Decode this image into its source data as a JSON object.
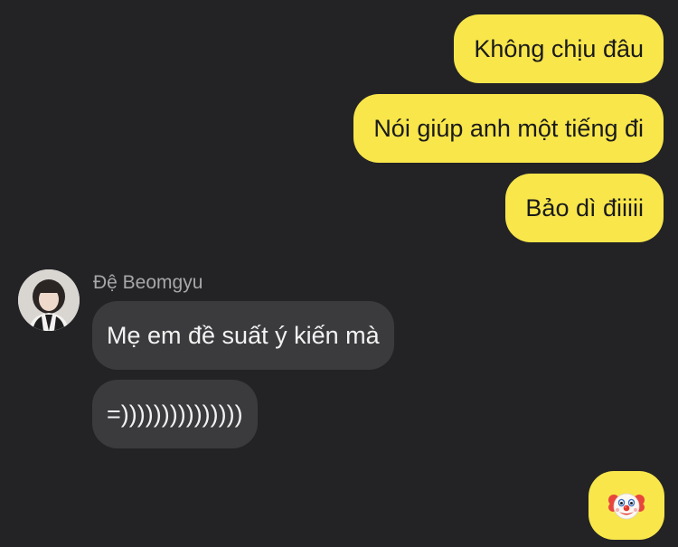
{
  "conversation": {
    "outgoing": [
      "Không chịu đâu",
      "Nói giúp anh một tiếng đi",
      "Bảo dì điiiii"
    ],
    "sender": {
      "name": "Đệ Beomgyu"
    },
    "incoming": [
      "Mẹ em đề suất ý kiến mà",
      "=)))))))))))))))"
    ],
    "final_emoji": "clown-face-emoji"
  },
  "colors": {
    "background": "#232325",
    "outgoing_bubble": "#f8e64b",
    "incoming_bubble": "#3b3b3d",
    "sender_name": "#a7a7aa"
  }
}
